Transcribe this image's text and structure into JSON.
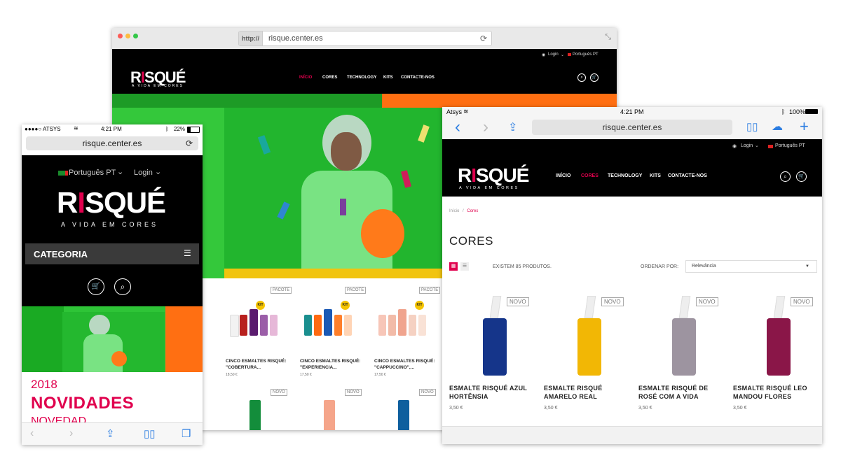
{
  "desktop": {
    "url_protocol": "http://",
    "url": "risque.center.es",
    "topbar": {
      "login": "Login",
      "language": "Português PT"
    },
    "brand": {
      "name_pre": "R",
      "name_i": "I",
      "name_post": "SQUÉ",
      "tagline": "A VIDA EM CORES"
    },
    "menu": [
      "INÍCIO",
      "CORES",
      "TECHNOLOGY",
      "KITS",
      "CONTACTE-NOS"
    ],
    "products": [
      {
        "tag": "PACOTE",
        "badge": "KIT",
        "name": "CINCO ESMALTES RISQUÉ: \"COBERTURA...",
        "price": "18,50 €",
        "colors": [
          "#f2f2f2",
          "#b8201e",
          "#5a1b6e",
          "#9b5ea8",
          "#e6b8d8"
        ]
      },
      {
        "tag": "PACOTE",
        "badge": "KIT",
        "name": "CINCO ESMALTES RISQUÉ: \"EXPERIENCIA...",
        "price": "17,50 €",
        "colors": [
          "#1a8f8f",
          "#ff6a12",
          "#1a59b5",
          "#ff7f2a",
          "#ffd4b5"
        ]
      },
      {
        "tag": "PACOTE",
        "badge": "KIT",
        "name": "CINCO ESMALTES RISQUÉ: \"CAPPUCCINO\",...",
        "price": "17,50 €",
        "colors": [
          "#f7c6b8",
          "#f2bba8",
          "#f0a48e",
          "#f5d1c2",
          "#f9e2d6"
        ]
      }
    ],
    "products_row2": [
      {
        "tag": "NOVO",
        "color": "#138d3b"
      },
      {
        "tag": "NOVO",
        "color": "#f5a58a"
      },
      {
        "tag": "NOVO",
        "color": "#0e5f9e"
      }
    ]
  },
  "phone": {
    "carrier": "●●●●○ ATSYS",
    "time": "4:21 PM",
    "battery": "22%",
    "url": "risque.center.es",
    "language": "Português PT",
    "login": "Login",
    "brand": {
      "name_pre": "R",
      "name_i": "I",
      "name_post": "SQUÉ",
      "tagline": "A VIDA EM CORES"
    },
    "category": "CATEGORIA",
    "year": "2018",
    "headline": "NOVIDADES",
    "subheadline": "NOVEDAD"
  },
  "tablet": {
    "carrier": "Atsys",
    "time": "4:21 PM",
    "battery": "100%",
    "url": "risque.center.es",
    "topbar": {
      "login": "Login",
      "language": "Português PT"
    },
    "brand": {
      "name_pre": "R",
      "name_i": "I",
      "name_post": "SQUÉ",
      "tagline": "A VIDA EM CORES"
    },
    "menu": [
      "INÍCIO",
      "CORES",
      "TECHNOLOGY",
      "KITS",
      "CONTACTE-NOS"
    ],
    "breadcrumb": {
      "home": "Início",
      "sep": "/",
      "current": "Cores"
    },
    "page_title": "CORES",
    "count_text": "EXISTEM 85 PRODUTOS.",
    "sort_label": "ORDENAR POR:",
    "sort_value": "Relevância",
    "products": [
      {
        "tag": "NOVO",
        "name_l1": "ESMALTE RISQUÉ AZUL",
        "name_l2": "HORTÊNSIA",
        "price": "3,50 €",
        "color": "#15358a"
      },
      {
        "tag": "NOVO",
        "name_l1": "ESMALTE RISQUÉ",
        "name_l2": "AMARELO REAL",
        "price": "3,50 €",
        "color": "#f2b705"
      },
      {
        "tag": "NOVO",
        "name_l1": "ESMALTE RISQUÉ DE",
        "name_l2": "ROSÉ COM A VIDA",
        "price": "3,50 €",
        "color": "#9d94a0"
      },
      {
        "tag": "NOVO",
        "name_l1": "ESMALTE RISQUÉ LEO",
        "name_l2": "MANDOU FLORES",
        "price": "3,50 €",
        "color": "#8a1648"
      }
    ]
  }
}
